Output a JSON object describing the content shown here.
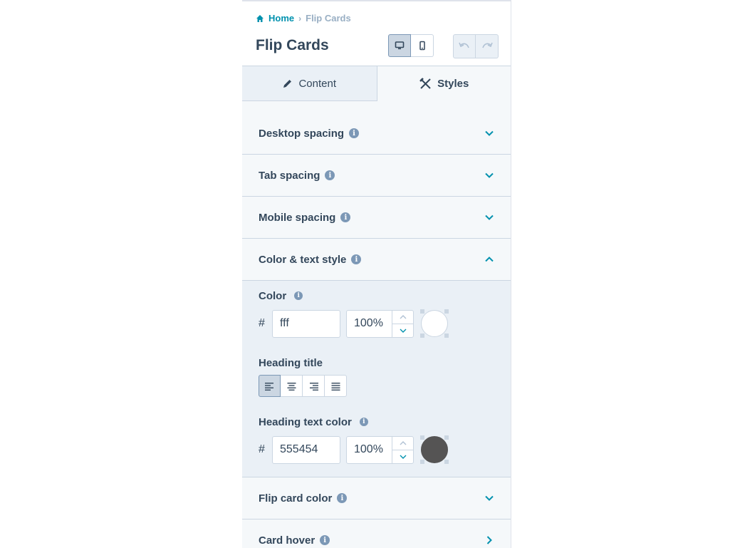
{
  "breadcrumb": {
    "home": "Home",
    "current": "Flip Cards"
  },
  "page_title": "Flip Cards",
  "tabs": [
    {
      "label": "Content",
      "icon": "pencil-icon",
      "active": false
    },
    {
      "label": "Styles",
      "icon": "styles-icon",
      "active": true
    }
  ],
  "sections": {
    "desktop_spacing": "Desktop spacing",
    "tab_spacing": "Tab spacing",
    "mobile_spacing": "Mobile spacing",
    "color_text_style": "Color & text style",
    "flip_card_color": "Flip card color",
    "card_hover": "Card hover"
  },
  "color_field": {
    "label": "Color",
    "hash": "#",
    "hex": "fff",
    "opacity": "100%",
    "swatch": "#ffffff"
  },
  "heading_title": {
    "label": "Heading title",
    "alignment": "left"
  },
  "heading_text_color": {
    "label": "Heading text color",
    "hash": "#",
    "hex": "555454",
    "opacity": "100%",
    "swatch": "#555454"
  },
  "colors": {
    "accent": "#0091ae",
    "text": "#33475b",
    "muted": "#99afc4",
    "icon": "#7c98b6"
  }
}
